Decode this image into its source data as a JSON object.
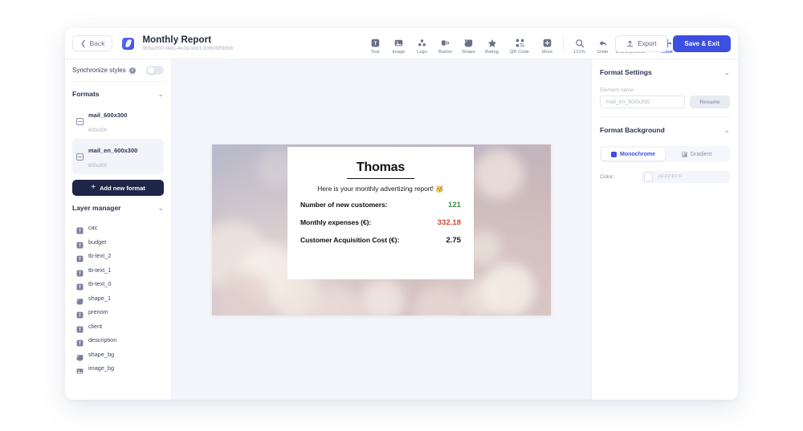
{
  "topbar": {
    "back_label": "Back",
    "title": "Monthly Report",
    "subtitle": "0b5ecf00-f481-4e3d-9d1f-30f609ff9696",
    "tools": [
      {
        "name": "text",
        "label": "Text"
      },
      {
        "name": "image",
        "label": "Image"
      },
      {
        "name": "logo",
        "label": "Logo"
      },
      {
        "name": "button",
        "label": "Button"
      },
      {
        "name": "shape",
        "label": "Shape"
      },
      {
        "name": "rating",
        "label": "Rating"
      },
      {
        "name": "qr-code",
        "label": "QR Code"
      },
      {
        "name": "more",
        "label": "More"
      }
    ],
    "view_tools": [
      {
        "name": "zoom",
        "label": "121%"
      },
      {
        "name": "undo",
        "label": "Undo"
      },
      {
        "name": "brand-presets",
        "label": "Brand presets"
      }
    ],
    "move_label": "Move",
    "export_label": "Export",
    "save_label": "Save & Exit"
  },
  "left_panel": {
    "synchronize_label": "Synchronize styles",
    "formats_title": "Formats",
    "formats": [
      {
        "name": "mail_600x300",
        "dimensions": "600x300",
        "selected": false
      },
      {
        "name": "mail_en_600x300",
        "dimensions": "600x300",
        "selected": true
      }
    ],
    "add_format_label": "Add new format",
    "layer_manager_title": "Layer manager",
    "layers": [
      {
        "name": "cac",
        "type": "text"
      },
      {
        "name": "budget",
        "type": "text"
      },
      {
        "name": "tb-text_2",
        "type": "text"
      },
      {
        "name": "tb-text_1",
        "type": "text"
      },
      {
        "name": "tb-text_0",
        "type": "text"
      },
      {
        "name": "shape_1",
        "type": "shape"
      },
      {
        "name": "prenom",
        "type": "text"
      },
      {
        "name": "client",
        "type": "text"
      },
      {
        "name": "description",
        "type": "text"
      },
      {
        "name": "shape_bg",
        "type": "shape"
      },
      {
        "name": "image_bg",
        "type": "image"
      }
    ]
  },
  "canvas": {
    "card": {
      "name": "Thomas",
      "description": "Here is your monthly advertizing report! 🥳",
      "rows": [
        {
          "label": "Number of new customers:",
          "value": "121",
          "color": "#3c8a4c"
        },
        {
          "label": "Monthly expenses (€):",
          "value": "332.18",
          "color": "#cf4a38"
        },
        {
          "label": "Customer Acquisition Cost (€):",
          "value": "2.75",
          "color": "#17181d"
        }
      ]
    }
  },
  "right_panel": {
    "format_settings_title": "Format Settings",
    "element_name_label": "Element name",
    "element_name_value": "mail_en_600x300",
    "rename_label": "Rename",
    "format_background_title": "Format Background",
    "background_modes": [
      {
        "name": "monochrome",
        "label": "Monochrome",
        "active": true
      },
      {
        "name": "gradient",
        "label": "Gradient",
        "active": false
      }
    ],
    "color_label": "Color:",
    "color_value": "#FFFFFF"
  },
  "theme": {
    "accent": "#3d4fe0",
    "dark": "#1e2547",
    "canvas_bg": "#f3f5fa"
  }
}
